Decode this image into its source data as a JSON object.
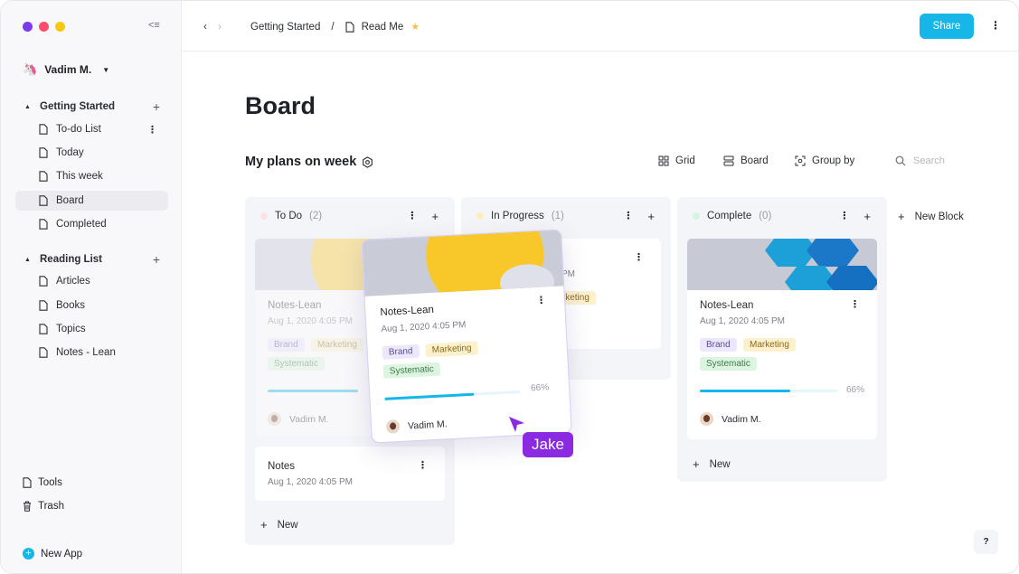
{
  "colors": {
    "accent": "#16b6e8",
    "traffic_red": "#fe4e6b",
    "traffic_purple": "#7c3aed",
    "traffic_yellow": "#f9c80e",
    "cursor": "#8a2be2",
    "todo_dot": "#fde0e4",
    "progress_dot": "#fdeebb",
    "complete_dot": "#d7f5db"
  },
  "sidebar": {
    "user_name": "Vadim M.",
    "sections": [
      {
        "title": "Getting Started",
        "items": [
          {
            "label": "To-do List"
          },
          {
            "label": "Today"
          },
          {
            "label": "This week"
          },
          {
            "label": "Board"
          },
          {
            "label": "Completed"
          }
        ]
      },
      {
        "title": "Reading List",
        "items": [
          {
            "label": "Articles"
          },
          {
            "label": "Books"
          },
          {
            "label": "Topics"
          },
          {
            "label": "Notes - Lean"
          }
        ]
      }
    ],
    "bottom": {
      "tools": "Tools",
      "trash": "Trash",
      "new_app": "New App"
    }
  },
  "header": {
    "breadcrumb": [
      "Getting Started",
      "Read Me"
    ],
    "separator": "/",
    "share": "Share"
  },
  "main": {
    "title": "Board",
    "subtitle": "My plans on week",
    "toolbar": {
      "grid": "Grid",
      "board": "Board",
      "group_by": "Group by",
      "search_placeholder": "Search"
    },
    "new_block": "New Block",
    "new_label": "New",
    "help": "?"
  },
  "columns": [
    {
      "title": "To Do",
      "count": "(2)"
    },
    {
      "title": "In Progress",
      "count": "(1)"
    },
    {
      "title": "Complete",
      "count": "(0)"
    }
  ],
  "cards": {
    "todo_ghost": {
      "title": "Notes-Lean",
      "date": "Aug 1, 2020 4:05 PM",
      "tags": [
        "Brand",
        "Marketing",
        "Systematic"
      ],
      "assignee": "Vadim M."
    },
    "todo_notes": {
      "title": "Notes",
      "date": "Aug 1, 2020 4:05 PM"
    },
    "progress_partial": {
      "tag": "Marketing",
      "date_fragment": "PM"
    },
    "complete": {
      "title": "Notes-Lean",
      "date": "Aug 1, 2020 4:05 PM",
      "tags": [
        "Brand",
        "Marketing",
        "Systematic"
      ],
      "progress": "66%",
      "progress_value": 0.66,
      "assignee": "Vadim M."
    },
    "dragging": {
      "title": "Notes-Lean",
      "date": "Aug 1, 2020 4:05 PM",
      "tags": [
        "Brand",
        "Marketing",
        "Systematic"
      ],
      "progress": "66%",
      "progress_value": 0.66,
      "assignee": "Vadim M."
    }
  },
  "cursor_label": "Jake"
}
